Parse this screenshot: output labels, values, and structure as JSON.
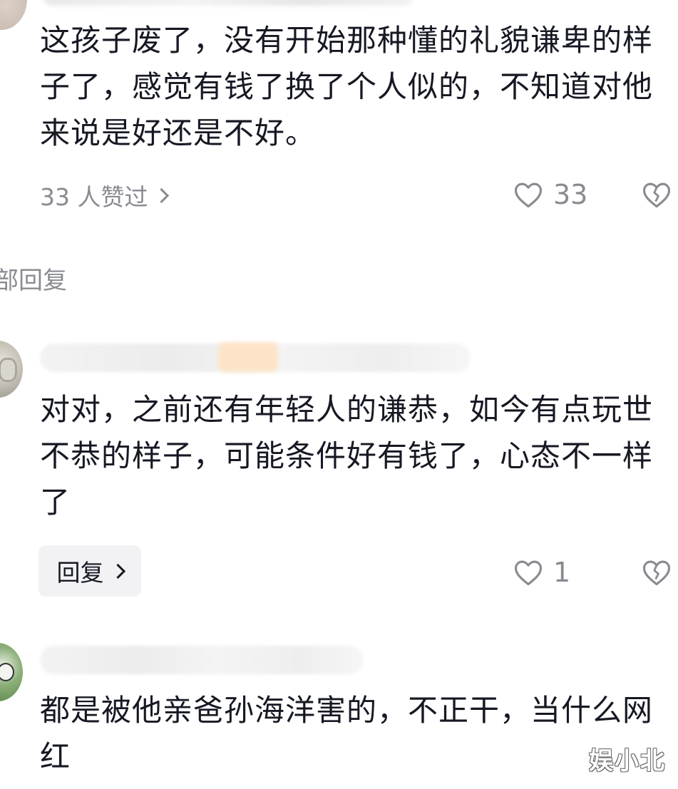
{
  "comments": [
    {
      "text": "这孩子废了，没有开始那种懂的礼貌谦卑的样子了，感觉有钱了换了个人似的，不知道对他来说是好还是不好。",
      "liked_by": "33 人赞过",
      "like_count": "33",
      "icons": {
        "like": "heart-outline-icon",
        "dislike": "broken-heart-icon",
        "chevron": "chevron-right-icon"
      }
    },
    {
      "text": "对对，之前还有年轻人的谦恭，如今有点玩世不恭的样子，可能条件好有钱了，心态不一样了",
      "reply_label": "回复",
      "like_count": "1",
      "icons": {
        "like": "heart-outline-icon",
        "dislike": "broken-heart-icon",
        "chevron": "chevron-right-icon"
      }
    },
    {
      "text": "都是被他亲爸孙海洋害的，不正干，当什么网红"
    }
  ],
  "section_label": "部回复",
  "watermark": "娱小北",
  "colors": {
    "text_primary": "#161823",
    "text_secondary": "#8a8b91",
    "reply_button_bg": "#f2f2f4"
  }
}
